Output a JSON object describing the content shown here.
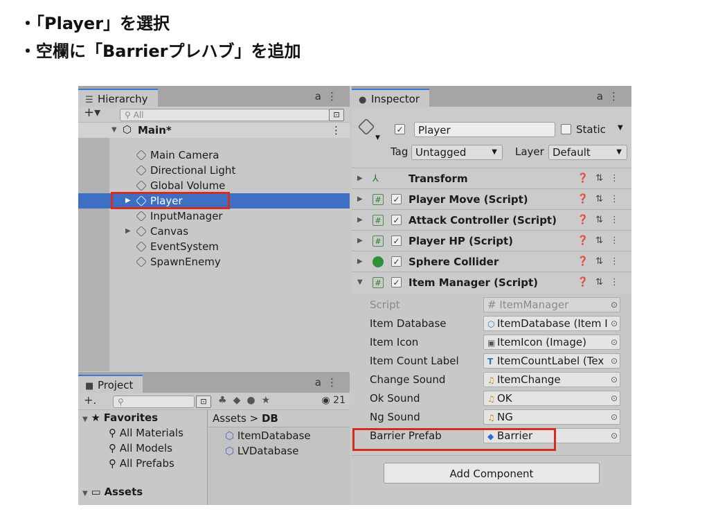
{
  "bullets": [
    "・「Player」を選択",
    "・空欄に「Barrierプレハブ」を追加"
  ],
  "hierarchy": {
    "tab_label": "Hierarchy",
    "tab_icon": "list-icon",
    "tools": "⌂ ⋮",
    "add_label": "+▾",
    "search_placeholder": "All",
    "scene_name": "Main*",
    "items": [
      {
        "label": "Main Camera"
      },
      {
        "label": "Directional Light"
      },
      {
        "label": "Global Volume"
      },
      {
        "label": "Player"
      },
      {
        "label": "InputManager"
      },
      {
        "label": "Canvas"
      },
      {
        "label": "EventSystem"
      },
      {
        "label": "SpawnEnemy"
      }
    ]
  },
  "project": {
    "tab_label": "Project",
    "add_label": "+.",
    "count": "21",
    "favorites_label": "Favorites",
    "favorites": [
      "All Materials",
      "All Models",
      "All Prefabs"
    ],
    "assets_label": "Assets",
    "breadcrumb_root": "Assets",
    "breadcrumb_sep": ">",
    "breadcrumb_current": "DB",
    "files": [
      "ItemDatabase",
      "LVDatabase"
    ]
  },
  "inspector": {
    "tab_label": "Inspector",
    "object_name": "Player",
    "static_label": "Static",
    "tag_label": "Tag",
    "tag_value": "Untagged",
    "layer_label": "Layer",
    "layer_value": "Default",
    "components": [
      {
        "name": "Transform"
      },
      {
        "name": "Player Move (Script)"
      },
      {
        "name": "Attack Controller (Script)"
      },
      {
        "name": "Player HP (Script)"
      },
      {
        "name": "Sphere Collider"
      },
      {
        "name": "Item Manager (Script)"
      }
    ],
    "fields": [
      {
        "label": "Script",
        "value": "ItemManager"
      },
      {
        "label": "Item Database",
        "value": "ItemDatabase (Item I"
      },
      {
        "label": "Item Icon",
        "value": "ItemIcon (Image)"
      },
      {
        "label": "Item Count Label",
        "value": "ItemCountLabel (Tex"
      },
      {
        "label": "Change Sound",
        "value": "ItemChange"
      },
      {
        "label": "Ok Sound",
        "value": "OK"
      },
      {
        "label": "Ng Sound",
        "value": "NG"
      },
      {
        "label": "Barrier Prefab",
        "value": "Barrier"
      }
    ],
    "add_component_label": "Add Component"
  },
  "colors": {
    "selection": "#3d6fc5",
    "highlight_box": "#d62b1f",
    "tab_accent": "#3a79d7"
  }
}
